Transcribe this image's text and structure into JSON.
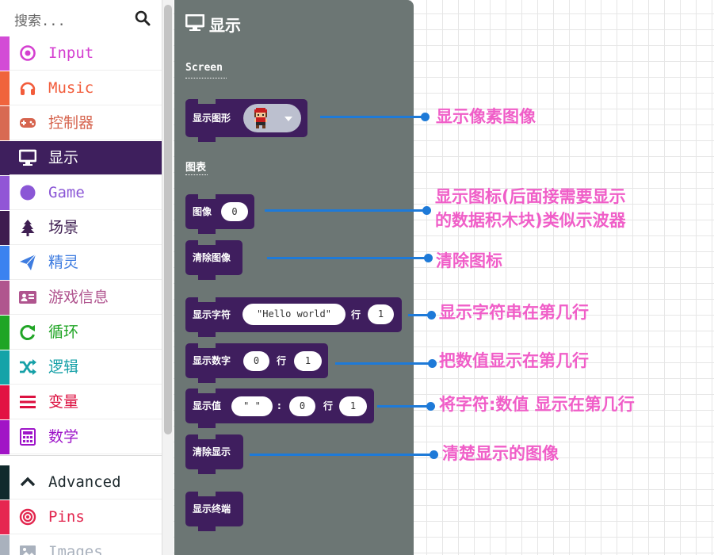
{
  "toolbox": {
    "search_placeholder": "搜索...",
    "categories": [
      {
        "label": "Input",
        "color": "#d43fd0",
        "stripe": "#d34bd6",
        "icon": "input-ring-icon"
      },
      {
        "label": "Music",
        "color": "#f25c3b",
        "stripe": "#f0643c",
        "icon": "headphones-icon"
      },
      {
        "label": "控制器",
        "color": "#d6644e",
        "stripe": "#d86a52",
        "icon": "gamepad-icon"
      },
      {
        "label": "显示",
        "color": "#ffffff",
        "stripe": "#3e1f5d",
        "icon": "monitor-icon",
        "selected": true
      },
      {
        "label": "Game",
        "color": "#8b57d6",
        "stripe": "#9156d6",
        "icon": "game-circle-icon"
      },
      {
        "label": "场景",
        "color": "#3f1f52",
        "stripe": "#3e1c4f",
        "icon": "tree-icon"
      },
      {
        "label": "精灵",
        "color": "#3e7ce0",
        "stripe": "#3b82f0",
        "icon": "paper-plane-icon"
      },
      {
        "label": "游戏信息",
        "color": "#b0558f",
        "stripe": "#b0568e",
        "icon": "id-card-icon"
      },
      {
        "label": "循环",
        "color": "#21a526",
        "stripe": "#1fa525",
        "icon": "loop-arrow-icon"
      },
      {
        "label": "逻辑",
        "color": "#15a0a7",
        "stripe": "#14a3a8",
        "icon": "shuffle-icon"
      },
      {
        "label": "变量",
        "color": "#dc1140",
        "stripe": "#e21243",
        "icon": "list-lines-icon"
      },
      {
        "label": "数学",
        "color": "#9e15c9",
        "stripe": "#a114c6",
        "icon": "calculator-icon"
      }
    ],
    "advanced": [
      {
        "label": "Advanced",
        "color": "#1e2a2e",
        "stripe": "#102a2c",
        "icon": "chevron-up-icon"
      },
      {
        "label": "Pins",
        "color": "#e2264e",
        "stripe": "#e62650",
        "icon": "target-icon"
      },
      {
        "label": "Images",
        "color": "#a9b1bd",
        "stripe": "#a9b1bd",
        "icon": "image-icon"
      }
    ]
  },
  "flyout": {
    "title": "显示",
    "section_screen": "Screen",
    "section_chart": "图表",
    "blocks": {
      "show_image": "显示图形",
      "plot": "图像",
      "plot_value": "0",
      "clear_plot": "清除图像",
      "show_string": "显示字符",
      "show_string_value": "\"Hello world\"",
      "row": "行",
      "show_string_row": "1",
      "show_number": "显示数字",
      "show_number_value": "0",
      "show_number_row": "1",
      "show_value": "显示值",
      "show_value_name": "\"  \"",
      "colon": ":",
      "show_value_value": "0",
      "show_value_row": "1",
      "clear_screen": "清除显示",
      "show_terminal": "显示终端"
    }
  },
  "annotations": {
    "a1": "显示像素图像",
    "a2_line1": "显示图标(后面接需要显示",
    "a2_line2": "的数据积木块)类似示波器",
    "a3": "清除图标",
    "a4": "显示字符串在第几行",
    "a5": "把数值显示在第几行",
    "a6": "将字符:数值 显示在第几行",
    "a7": "清楚显示的图像"
  },
  "colors": {
    "accent_annotation": "#f05ec8",
    "arrow": "#1e7ad8",
    "block": "#3f1e5e",
    "flyout_bg": "#6c7674"
  }
}
